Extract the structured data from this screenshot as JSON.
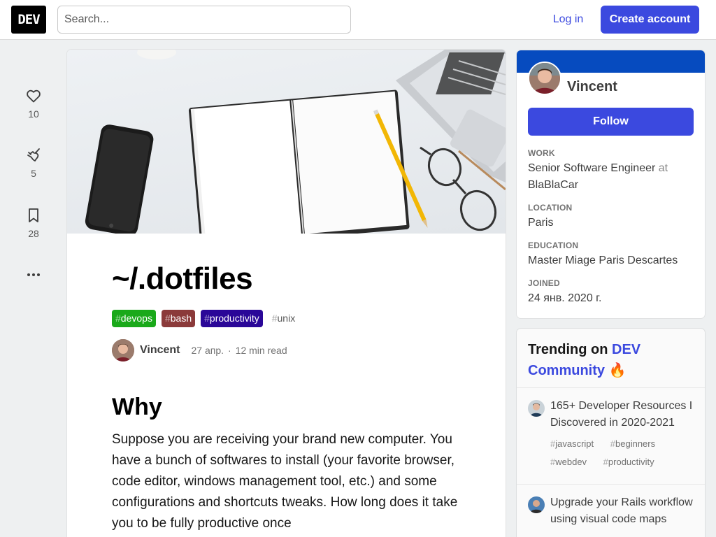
{
  "header": {
    "logo": "DEV",
    "search_placeholder": "Search...",
    "login_label": "Log in",
    "create_account_label": "Create account"
  },
  "reactions": {
    "likes": "10",
    "unicorns": "5",
    "bookmarks": "28"
  },
  "article": {
    "title": "~/.dotfiles",
    "tags": [
      {
        "name": "devops",
        "color": "#1aa91a"
      },
      {
        "name": "bash",
        "color": "#8b3a3a"
      },
      {
        "name": "productivity",
        "color": "#2a0798"
      },
      {
        "name": "unix",
        "color": ""
      }
    ],
    "hash": "#",
    "author": "Vincent",
    "date": "27 апр.",
    "read_time": "12 min read",
    "section_heading": "Why",
    "paragraph": "Suppose you are receiving your brand new computer. You have a bunch of softwares to install (your favorite browser, code editor, windows management tool, etc.) and some configurations and shortcuts tweaks. How long does it take you to be fully productive once"
  },
  "profile": {
    "name": "Vincent",
    "follow_label": "Follow",
    "brand_color": "#064bbf",
    "work_label": "Work",
    "work_role": "Senior Software Engineer",
    "work_at": "at",
    "work_company": "BlaBlaCar",
    "location_label": "Location",
    "location": "Paris",
    "education_label": "Education",
    "education": "Master Miage Paris Descartes",
    "joined_label": "Joined",
    "joined": "24 янв. 2020 г."
  },
  "trending": {
    "heading_prefix": "Trending on",
    "heading_dev": "DEV",
    "heading_community": "Community",
    "heading_emoji": "🔥",
    "items": [
      {
        "title": "165+ Developer Resources I Discovered in 2020-2021",
        "tags": [
          "javascript",
          "beginners",
          "webdev",
          "productivity"
        ]
      },
      {
        "title": "Upgrade your Rails workflow using visual code maps",
        "tags": []
      }
    ]
  }
}
